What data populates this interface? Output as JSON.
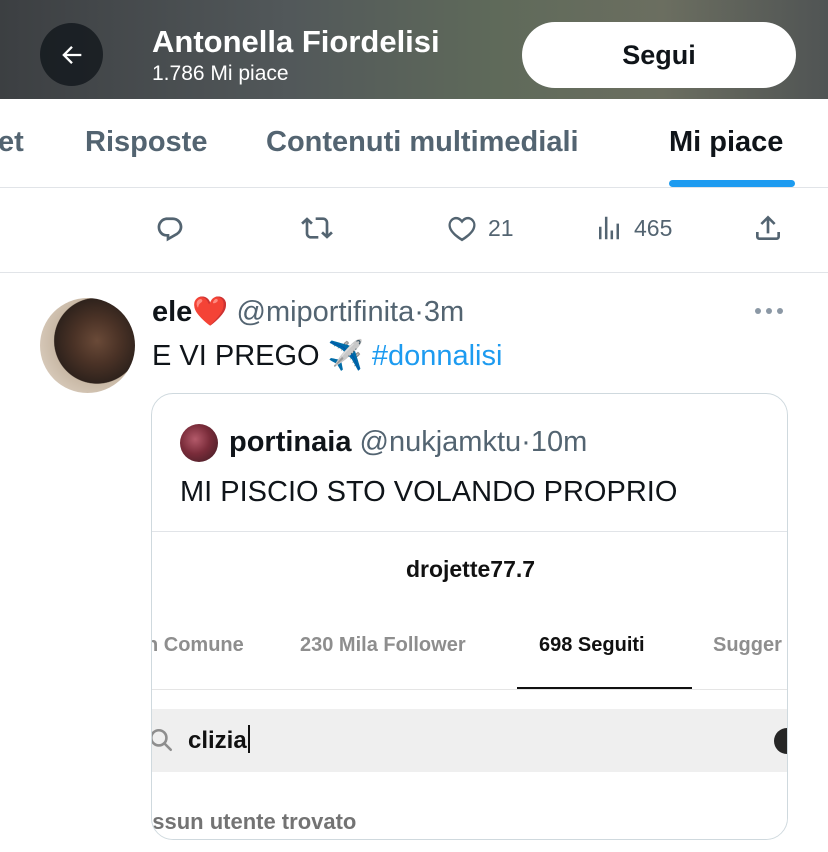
{
  "header": {
    "name": "Antonella Fiordelisi",
    "likes_count": "1.786 Mi piace",
    "follow_label": "Segui"
  },
  "tabs": [
    {
      "label": "et"
    },
    {
      "label": "Risposte"
    },
    {
      "label": "Contenuti multimediali"
    },
    {
      "label": "Mi piace",
      "active": true
    }
  ],
  "actions": {
    "reply_icon": "reply-icon",
    "retweet_icon": "retweet-icon",
    "like_count": "21",
    "views_count": "465",
    "share_icon": "share-icon"
  },
  "tweet": {
    "display_name": "ele❤️",
    "handle": "@miportifinita",
    "dot": "·",
    "time": "3m",
    "text": "E VI PREGO ✈️ ",
    "hashtag": "#donnalisi"
  },
  "quote": {
    "display_name": "portinaia",
    "handle": "@nukjamktu",
    "dot": "·",
    "time": "10m",
    "text": "MI PISCIO STO VOLANDO PROPRIO",
    "media": {
      "username": "drojette77.7",
      "tabs": [
        "n Comune",
        "230 Mila Follower",
        "698 Seguiti",
        "Sugger"
      ],
      "active_tab": "698 Seguiti",
      "search_value": "clizia",
      "no_results": "essun utente trovato"
    }
  },
  "colors": {
    "accent": "#1d9bf0",
    "text_primary": "#0f1419",
    "text_secondary": "#536471"
  }
}
